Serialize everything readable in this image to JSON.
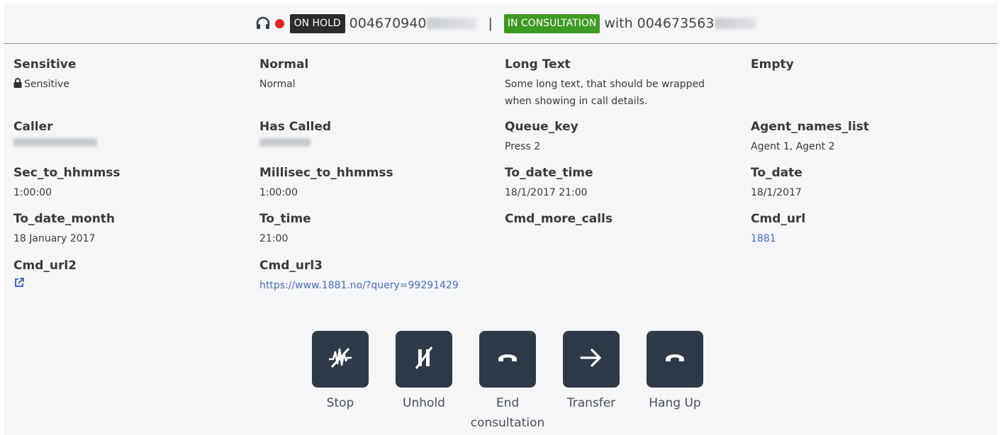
{
  "status_bar": {
    "hold_badge": "ON HOLD",
    "hold_number": "004670940",
    "separator": "|",
    "consult_badge": "IN CONSULTATION",
    "with_label": "with",
    "consult_number": "004673563",
    "colors": {
      "hold": "#2b2b2b",
      "consult": "#3f9a23",
      "recording": "#e32626"
    }
  },
  "details": [
    {
      "label": "Sensitive",
      "value": "Sensitive",
      "icon": "lock-icon"
    },
    {
      "label": "Normal",
      "value": "Normal"
    },
    {
      "label": "Long Text",
      "value": "Some long text, that should be wrapped when showing in call details."
    },
    {
      "label": "Empty",
      "value": ""
    },
    {
      "label": "Caller",
      "value": ""
    },
    {
      "label": "Has Called",
      "value": ""
    },
    {
      "label": "Queue_key",
      "value": "Press 2"
    },
    {
      "label": "Agent_names_list",
      "value": "Agent 1, Agent 2"
    },
    {
      "label": "Sec_to_hhmmss",
      "value": "1:00:00"
    },
    {
      "label": "Millisec_to_hhmmss",
      "value": "1:00:00"
    },
    {
      "label": "To_date_time",
      "value": "18/1/2017 21:00"
    },
    {
      "label": "To_date",
      "value": "18/1/2017"
    },
    {
      "label": "To_date_month",
      "value": "18 January 2017"
    },
    {
      "label": "To_time",
      "value": "21:00"
    },
    {
      "label": "Cmd_more_calls",
      "value": ""
    },
    {
      "label": "Cmd_url",
      "value": "1881"
    },
    {
      "label": "Cmd_url2",
      "value": "",
      "icon": "external-link-icon"
    },
    {
      "label": "Cmd_url3",
      "value": "https://www.1881.no/?query=99291429"
    }
  ],
  "actions": [
    {
      "label": "Stop",
      "icon": "stop-recording-icon"
    },
    {
      "label": "Unhold",
      "icon": "unhold-icon"
    },
    {
      "label": "End consultation",
      "icon": "end-call-icon"
    },
    {
      "label": "Transfer",
      "icon": "arrow-right-icon"
    },
    {
      "label": "Hang Up",
      "icon": "hang-up-icon"
    }
  ],
  "link_color": "#4a6bc4",
  "button_color": "#2e3a48"
}
